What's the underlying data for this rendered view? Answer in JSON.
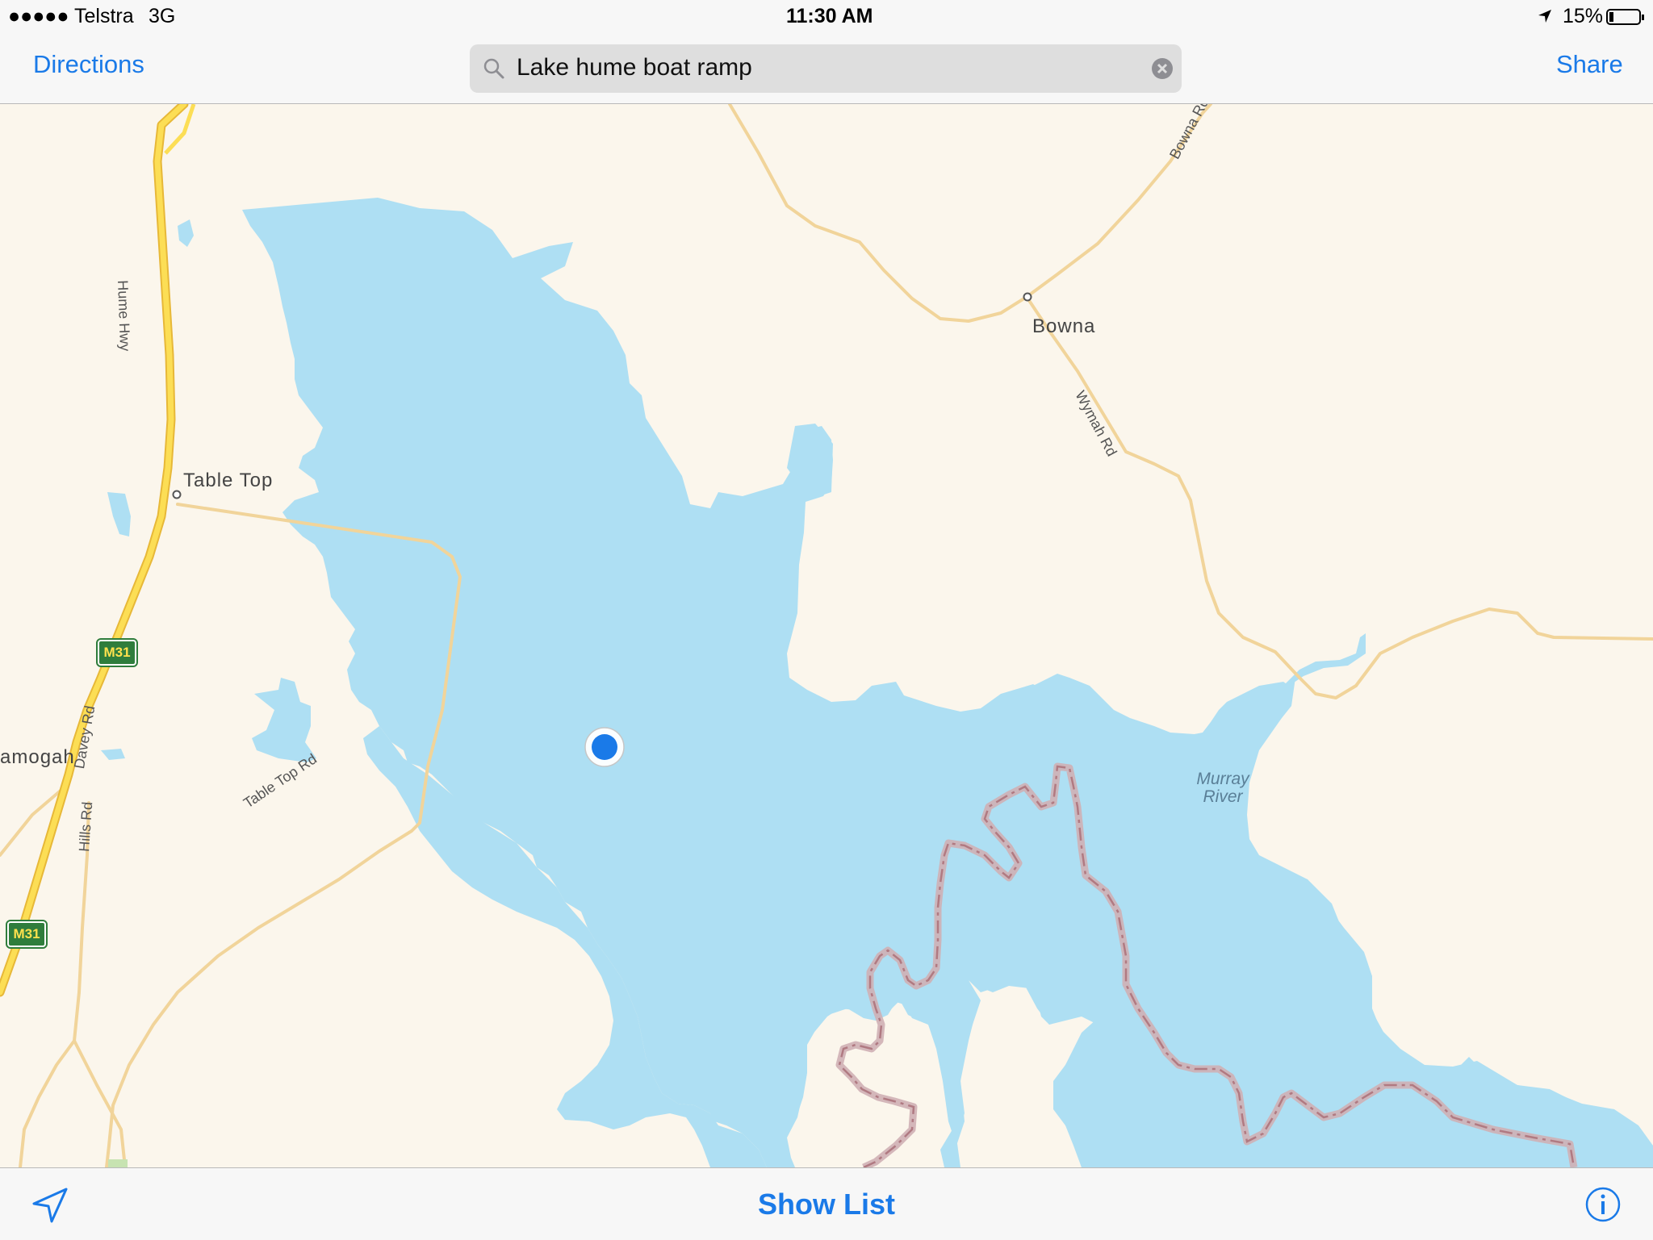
{
  "status_bar": {
    "carrier": "●●●●● Telstra",
    "network": "3G",
    "time": "11:30 AM",
    "battery": "15%"
  },
  "nav_bar": {
    "directions_label": "Directions",
    "search_value": "Lake hume boat ramp",
    "share_label": "Share"
  },
  "map": {
    "places": [
      "Table Top",
      "Bowna",
      "amogah"
    ],
    "roads": [
      "Hume Hwy",
      "Table Top Rd",
      "Davey Rd",
      "Hills Rd",
      "Wymah Rd",
      "Bowna Rd"
    ],
    "route_shields": [
      "M31",
      "M31"
    ],
    "water_label": [
      "Murray",
      "River"
    ],
    "colors": {
      "land": "#fbf6ec",
      "water": "#aedff3",
      "highway": "#f9d84a",
      "road": "#f3d9a4",
      "border": "#c49ba0",
      "location_dot": "#1a7ae8"
    }
  },
  "bottom_bar": {
    "show_list_label": "Show List",
    "location_icon": "location-arrow-icon",
    "info_icon": "info-icon"
  }
}
